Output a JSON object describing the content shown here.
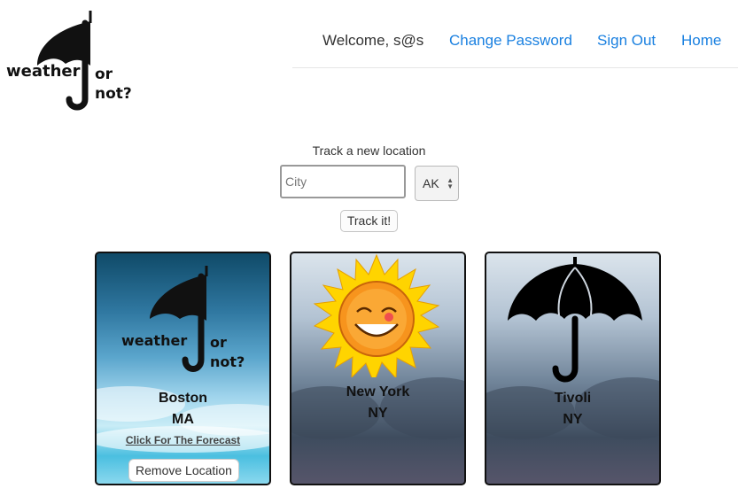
{
  "logo": {
    "word_left": "weather",
    "word_or": "or",
    "word_not": "not?"
  },
  "nav": {
    "welcome": "Welcome, s@s",
    "change_password": "Change Password",
    "sign_out": "Sign Out",
    "home": "Home"
  },
  "tracker": {
    "label": "Track a new location",
    "city_placeholder": "City",
    "city_value": "",
    "state_selected": "AK",
    "button_label": "Track it!"
  },
  "cards": [
    {
      "city": "Boston",
      "state": "MA",
      "link": "Click For The Forecast",
      "remove": "Remove Location",
      "icon": "weather-or-not-logo-icon"
    },
    {
      "city": "New York",
      "state": "NY",
      "icon": "sun-icon"
    },
    {
      "city": "Tivoli",
      "state": "NY",
      "icon": "umbrella-icon"
    }
  ],
  "colors": {
    "link": "#1a80e0",
    "card_border": "#111111"
  }
}
